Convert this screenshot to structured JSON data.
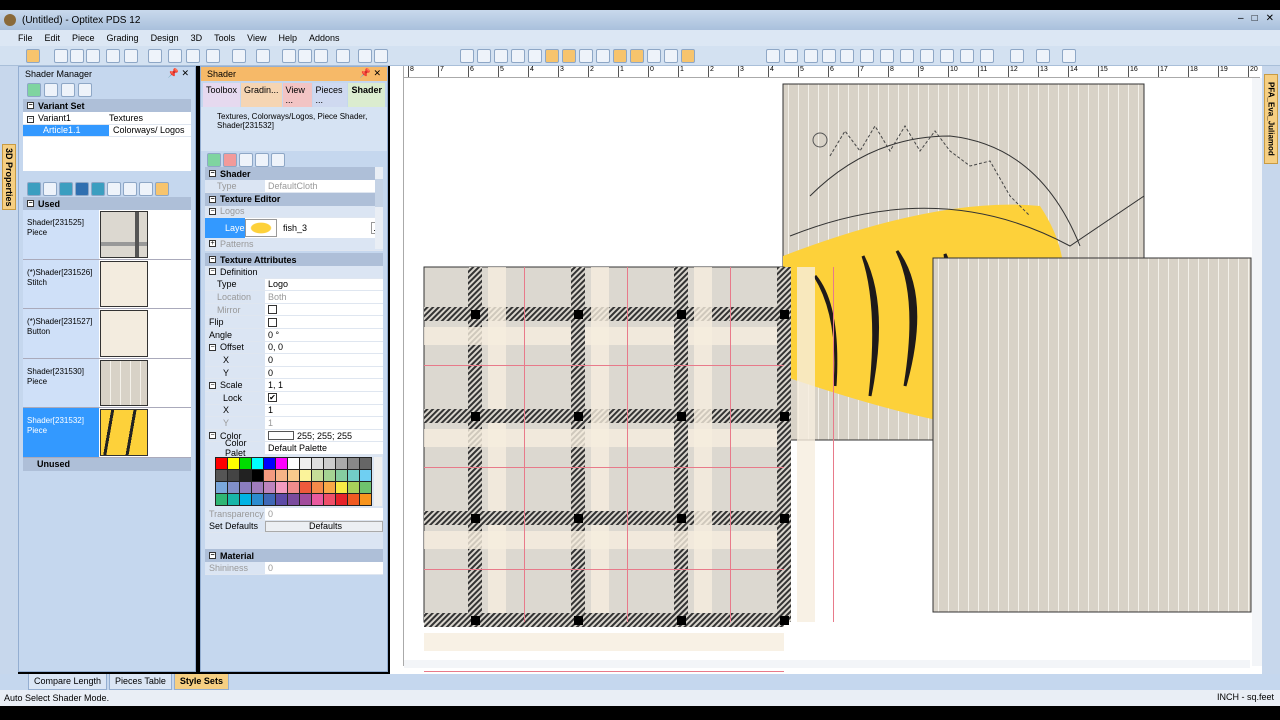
{
  "window": {
    "title": "(Untitled) - Optitex PDS 12",
    "controls": [
      "–",
      "□",
      "✕"
    ]
  },
  "menu": [
    "File",
    "Edit",
    "Piece",
    "Grading",
    "Design",
    "3D",
    "Tools",
    "View",
    "Help",
    "Addons"
  ],
  "left_side_tab": "3D Properties",
  "right_side_tab": "PFA_Eva_Juliamod",
  "shader_manager": {
    "title": "Shader Manager",
    "variant_set": {
      "label": "Variant Set",
      "rows": [
        {
          "name": "Variant1",
          "value": "Textures"
        },
        {
          "name": "Article1.1",
          "value": "Colorways/ Logos"
        }
      ]
    },
    "used_label": "Used",
    "unused_label": "Unused",
    "used": [
      {
        "name": "Shader[231525]",
        "type": "Piece",
        "thumb": "plaid"
      },
      {
        "name": "(*)Shader[231526]",
        "type": "Stitch",
        "thumb": "cream"
      },
      {
        "name": "(*)Shader[231527]",
        "type": "Button",
        "thumb": "cream"
      },
      {
        "name": "Shader[231530]",
        "type": "Piece",
        "thumb": "stripe"
      },
      {
        "name": "Shader[231532]",
        "type": "Piece",
        "thumb": "fish",
        "selected": true
      }
    ]
  },
  "shader_panel": {
    "title": "Shader",
    "tabs": [
      "Toolbox",
      "Gradin...",
      "View ...",
      "Pieces ...",
      "Shader"
    ],
    "description": "Textures, Colorways/Logos, Piece Shader, Shader[231532]",
    "shader_cat": "Shader",
    "type_label": "Type",
    "type_value": "DefaultCloth",
    "texture_editor": "Texture Editor",
    "logos": "Logos",
    "layer_label": "Layer",
    "layer_value": "fish_3",
    "layer_btn": "...",
    "patterns": "Patterns",
    "texture_attributes": "Texture Attributes",
    "definition": "Definition",
    "def_type_label": "Type",
    "def_type_value": "Logo",
    "location_label": "Location",
    "location_value": "Both",
    "mirror_label": "Mirror",
    "flip_label": "Flip",
    "angle_label": "Angle",
    "angle_value": "0 °",
    "offset_label": "Offset",
    "offset_value": "0, 0",
    "offset_x_label": "X",
    "offset_x": "0",
    "offset_y_label": "Y",
    "offset_y": "0",
    "scale_label": "Scale",
    "scale_value": "1, 1",
    "lock_label": "Lock",
    "lock_check": "✔",
    "scale_x_label": "X",
    "scale_x": "1",
    "scale_y_label": "Y",
    "scale_y": "1",
    "color_label": "Color",
    "color_value": "255; 255; 255",
    "palette_label": "Color Palet",
    "palette_value": "Default Palette",
    "palette": [
      "#ff0000",
      "#ffff00",
      "#00dd00",
      "#00ffff",
      "#0000ff",
      "#ff00ff",
      "#ffffff",
      "#eeeeee",
      "#dddddd",
      "#cccccc",
      "#aaaaaa",
      "#888888",
      "#666666",
      "#555555",
      "#444444",
      "#222222",
      "#000000",
      "#f49a80",
      "#f7b387",
      "#f9c98c",
      "#fbf39a",
      "#c6dd98",
      "#a5d393",
      "#86cca0",
      "#72ccc6",
      "#6fcff2",
      "#7aa8dc",
      "#8190ca",
      "#8b7ec0",
      "#a07cbd",
      "#bd84be",
      "#f29bc0",
      "#f08c8c",
      "#ee5a3c",
      "#f58a4a",
      "#f9a847",
      "#f8ea45",
      "#a7d05a",
      "#6fc26e",
      "#2fb573",
      "#17b6a8",
      "#00b3e4",
      "#2c8ccf",
      "#3f68b6",
      "#5c4aa6",
      "#7a4b9e",
      "#a14c9d",
      "#e95aa0",
      "#ee4f6a",
      "#e6232b",
      "#f05a22",
      "#f7941d"
    ],
    "transparency_label": "Transparency",
    "transparency_value": "0",
    "set_defaults_label": "Set Defaults",
    "defaults_btn": "Defaults",
    "material": "Material",
    "shininess_label": "Shininess",
    "shininess_value": "0"
  },
  "ruler_top": [
    "8",
    "7",
    "6",
    "5",
    "4",
    "3",
    "2",
    "1",
    "0",
    "1",
    "2",
    "3",
    "4",
    "5",
    "6",
    "7",
    "8",
    "9",
    "10",
    "11",
    "12",
    "13",
    "14",
    "15",
    "16",
    "17",
    "18",
    "19",
    "20"
  ],
  "bottom_tabs": [
    "Compare Length",
    "Pieces Table",
    "Style Sets"
  ],
  "status": {
    "message": "Auto Select Shader Mode.",
    "units": "INCH - sq.feet"
  },
  "colors": {
    "accent": "#3399ff",
    "fish_yellow": "#fdd13a",
    "fabric": "#d8d2c7",
    "plaid_red": "#e87a8a"
  }
}
